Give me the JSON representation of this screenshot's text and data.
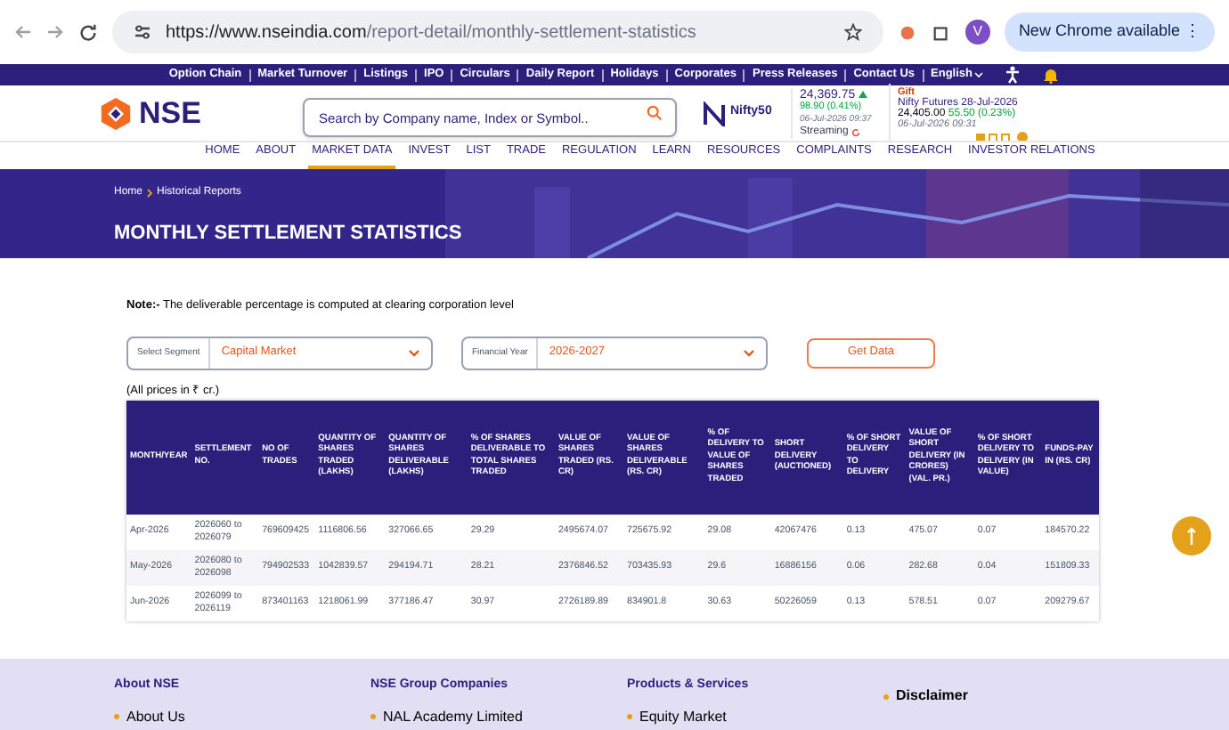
{
  "browser": {
    "url_host": "https://www.nseindia.com",
    "url_path": "/report-detail/monthly-settlement-statistics",
    "avatar": "V",
    "update_button": "New Chrome available",
    "menu_glyph": "⋮"
  },
  "top_links": [
    "Option Chain",
    "Market Turnover",
    "Listings",
    "IPO",
    "Circulars",
    "Daily Report",
    "Holidays",
    "Corporates",
    "Press Releases",
    "Contact Us"
  ],
  "language": "English",
  "logo": "NSE",
  "search": {
    "placeholder": "Search by Company name, Index or Symbol.."
  },
  "ticker": {
    "index_name": "Nifty50",
    "value": "24,369.75",
    "change": "98.90 (0.41%)",
    "time": "06-Jul-2026 09:37",
    "streaming": "Streaming",
    "tag": "Gift",
    "future_name": "Nifty Futures 28-Jul-2026",
    "future_value": "24,405.00",
    "future_change": "55.50 (0.23%)",
    "future_time": "06-Jul-2026 09:31",
    "slides": [
      {
        "selected": true
      },
      {
        "selected": false
      },
      {
        "selected": false
      }
    ]
  },
  "nav": [
    {
      "label": "HOME",
      "selected": false
    },
    {
      "label": "ABOUT",
      "selected": false
    },
    {
      "label": "MARKET DATA",
      "selected": true
    },
    {
      "label": "INVEST",
      "selected": false
    },
    {
      "label": "LIST",
      "selected": false
    },
    {
      "label": "TRADE",
      "selected": false
    },
    {
      "label": "REGULATION",
      "selected": false
    },
    {
      "label": "LEARN",
      "selected": false
    },
    {
      "label": "RESOURCES",
      "selected": false
    },
    {
      "label": "COMPLAINTS",
      "selected": false
    },
    {
      "label": "RESEARCH",
      "selected": false
    },
    {
      "label": "INVESTOR RELATIONS",
      "selected": false
    }
  ],
  "breadcrumb": [
    "Home",
    "Historical Reports"
  ],
  "page_title": "MONTHLY SETTLEMENT STATISTICS",
  "note": "**Note:-** The deliverable percentage is computed at clearing corporation level",
  "filters": [
    {
      "label": "Select Segment",
      "value": "Capital Market"
    },
    {
      "label": "Financial Year",
      "value": "2026-2027"
    }
  ],
  "get_data_button": "Get Data",
  "prices_note": "(All prices in ₹ cr.)",
  "table": {
    "columns": [
      "MONTH/YEAR",
      "SETTLEMENT NO.",
      "NO OF TRADES",
      "QUANTITY OF SHARES TRADED (LAKHS)",
      "QUANTITY OF SHARES DELIVERABLE (LAKHS)",
      "% OF SHARES DELIVERABLE TO TOTAL SHARES TRADED",
      "VALUE OF SHARES TRADED (RS. CR)",
      "VALUE OF SHARES DELIVERABLE (RS. CR)",
      "% OF DELIVERY TO VALUE OF SHARES TRADED",
      "SHORT DELIVERY (AUCTIONED)",
      "% OF SHORT DELIVERY TO DELIVERY",
      "VALUE OF SHORT DELIVERY (IN CRORES) (VAL. PR.)",
      "% OF SHORT DELIVERY TO DELIVERY (IN VALUE)",
      "FUNDS-PAY IN (RS. CR)"
    ],
    "rows": [
      [
        "Apr-2026",
        "2026060 to 2026079",
        "769609425",
        "1116806.56",
        "327066.65",
        "29.29",
        "2495674.07",
        "725675.92",
        "29.08",
        "42067476",
        "0.13",
        "475.07",
        "0.07",
        "184570.22"
      ],
      [
        "May-2026",
        "2026080 to 2026098",
        "794902533",
        "1042839.57",
        "294194.71",
        "28.21",
        "2376846.52",
        "703435.93",
        "29.6",
        "16886156",
        "0.06",
        "282.68",
        "0.04",
        "151809.33"
      ],
      [
        "Jun-2026",
        "2026099 to 2026119",
        "873401163",
        "1218061.99",
        "377186.47",
        "30.97",
        "2726189.89",
        "834901.8",
        "30.63",
        "50226059",
        "0.13",
        "578.51",
        "0.07",
        "209279.67"
      ]
    ]
  },
  "footer": [
    {
      "heading": "About NSE",
      "item": "About Us"
    },
    {
      "heading": "NSE Group Companies",
      "item": "NAL Academy Limited"
    },
    {
      "heading": "Products & Services",
      "item": "Equity Market"
    },
    {
      "item": "Disclaimer"
    }
  ]
}
